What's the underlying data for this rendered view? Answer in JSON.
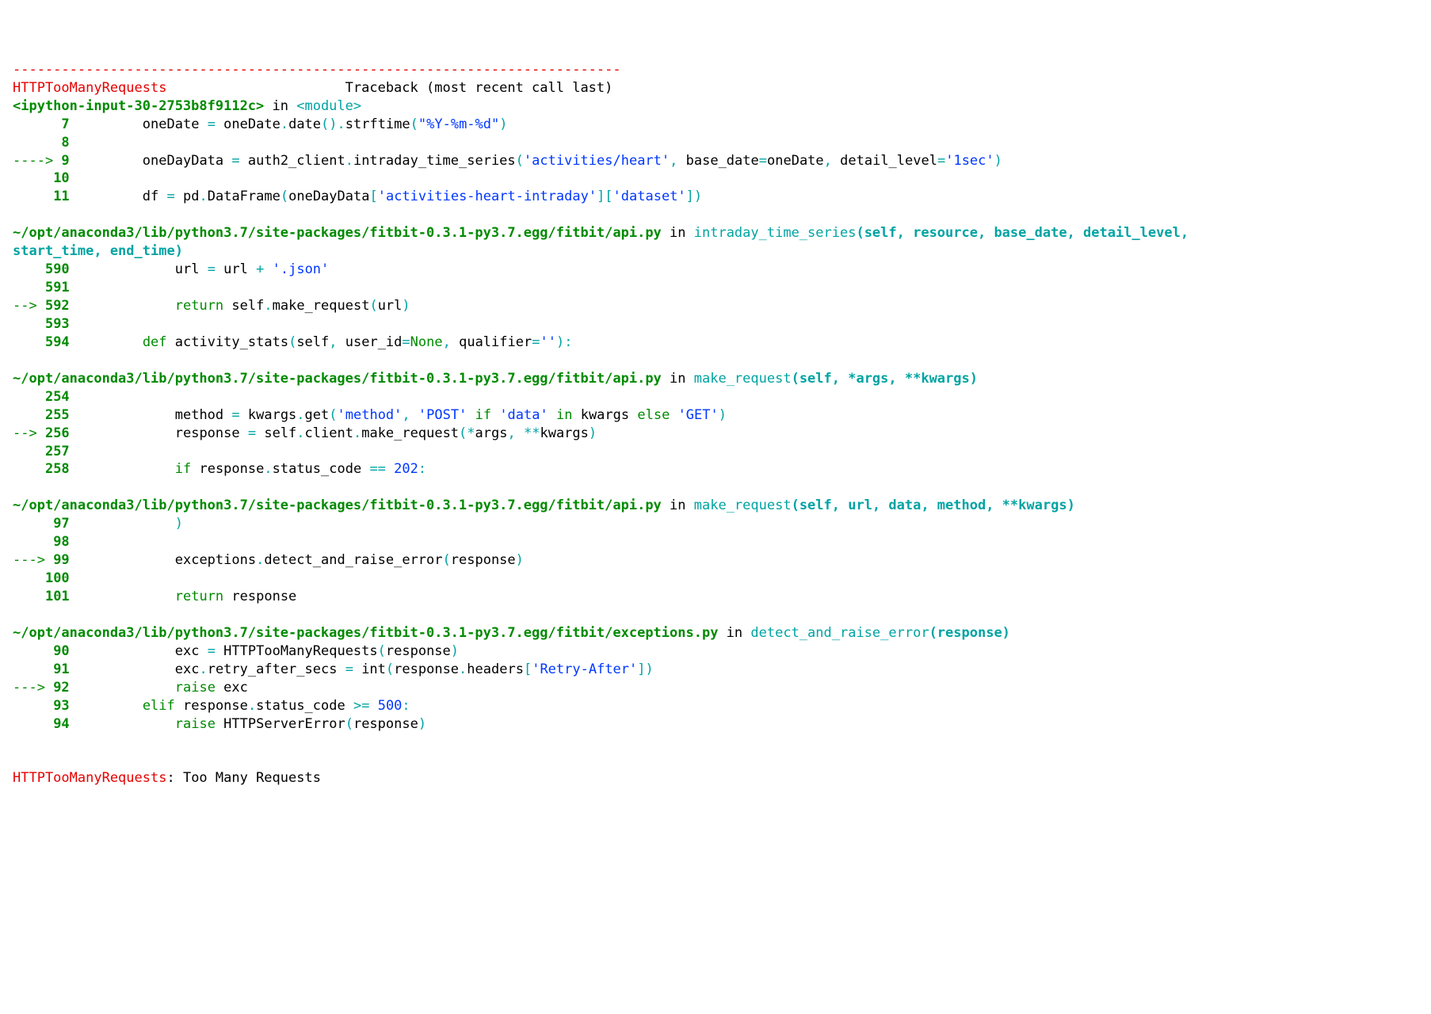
{
  "separator": "---------------------------------------------------------------------------",
  "header": {
    "exc_name": "HTTPTooManyRequests",
    "traceback_label": "Traceback (most recent call last)"
  },
  "frames": [
    {
      "loc_pre": "<ipython-input-30-2753b8f9112c>",
      "loc_join": " in ",
      "loc_func": "<module>",
      "lines": [
        {
          "arrow": false,
          "num": "7",
          "tokens": [
            {
              "t": "plain",
              "v": "        oneDate "
            },
            {
              "t": "cyan",
              "v": "="
            },
            {
              "t": "plain",
              "v": " oneDate"
            },
            {
              "t": "cyan",
              "v": "."
            },
            {
              "t": "plain",
              "v": "date"
            },
            {
              "t": "cyan",
              "v": "()."
            },
            {
              "t": "plain",
              "v": "strftime"
            },
            {
              "t": "cyan",
              "v": "("
            },
            {
              "t": "blue",
              "v": "\"%Y-%m-%d\""
            },
            {
              "t": "cyan",
              "v": ")"
            }
          ]
        },
        {
          "arrow": false,
          "num": "8",
          "tokens": []
        },
        {
          "arrow": true,
          "num": "9",
          "tokens": [
            {
              "t": "plain",
              "v": "        oneDayData "
            },
            {
              "t": "cyan",
              "v": "="
            },
            {
              "t": "plain",
              "v": " auth2_client"
            },
            {
              "t": "cyan",
              "v": "."
            },
            {
              "t": "plain",
              "v": "intraday_time_series"
            },
            {
              "t": "cyan",
              "v": "("
            },
            {
              "t": "blue",
              "v": "'activities/heart'"
            },
            {
              "t": "cyan",
              "v": ","
            },
            {
              "t": "plain",
              "v": " base_date"
            },
            {
              "t": "cyan",
              "v": "="
            },
            {
              "t": "plain",
              "v": "oneDate"
            },
            {
              "t": "cyan",
              "v": ","
            },
            {
              "t": "plain",
              "v": " detail_level"
            },
            {
              "t": "cyan",
              "v": "="
            },
            {
              "t": "blue",
              "v": "'1sec'"
            },
            {
              "t": "cyan",
              "v": ")"
            }
          ]
        },
        {
          "arrow": false,
          "num": "10",
          "tokens": []
        },
        {
          "arrow": false,
          "num": "11",
          "tokens": [
            {
              "t": "plain",
              "v": "        df "
            },
            {
              "t": "cyan",
              "v": "="
            },
            {
              "t": "plain",
              "v": " pd"
            },
            {
              "t": "cyan",
              "v": "."
            },
            {
              "t": "plain",
              "v": "DataFrame"
            },
            {
              "t": "cyan",
              "v": "("
            },
            {
              "t": "plain",
              "v": "oneDayData"
            },
            {
              "t": "cyan",
              "v": "["
            },
            {
              "t": "blue",
              "v": "'activities-heart-intraday'"
            },
            {
              "t": "cyan",
              "v": "]["
            },
            {
              "t": "blue",
              "v": "'dataset'"
            },
            {
              "t": "cyan",
              "v": "])"
            }
          ]
        }
      ]
    },
    {
      "loc_pre": "~/opt/anaconda3/lib/python3.7/site-packages/fitbit-0.3.1-py3.7.egg/fitbit/api.py",
      "loc_join": " in ",
      "loc_func": "intraday_time_series",
      "loc_sig": "(self, resource, base_date, detail_level, start_time, end_time)",
      "lines": [
        {
          "arrow": false,
          "num": "590",
          "tokens": [
            {
              "t": "plain",
              "v": "            url "
            },
            {
              "t": "cyan",
              "v": "="
            },
            {
              "t": "plain",
              "v": " url "
            },
            {
              "t": "cyan",
              "v": "+"
            },
            {
              "t": "plain",
              "v": " "
            },
            {
              "t": "blue",
              "v": "'.json'"
            }
          ]
        },
        {
          "arrow": false,
          "num": "591",
          "tokens": []
        },
        {
          "arrow": true,
          "num": "592",
          "tokens": [
            {
              "t": "plain",
              "v": "            "
            },
            {
              "t": "green",
              "v": "return"
            },
            {
              "t": "plain",
              "v": " self"
            },
            {
              "t": "cyan",
              "v": "."
            },
            {
              "t": "plain",
              "v": "make_request"
            },
            {
              "t": "cyan",
              "v": "("
            },
            {
              "t": "plain",
              "v": "url"
            },
            {
              "t": "cyan",
              "v": ")"
            }
          ]
        },
        {
          "arrow": false,
          "num": "593",
          "tokens": []
        },
        {
          "arrow": false,
          "num": "594",
          "tokens": [
            {
              "t": "plain",
              "v": "        "
            },
            {
              "t": "green",
              "v": "def"
            },
            {
              "t": "plain",
              "v": " activity_stats"
            },
            {
              "t": "cyan",
              "v": "("
            },
            {
              "t": "plain",
              "v": "self"
            },
            {
              "t": "cyan",
              "v": ","
            },
            {
              "t": "plain",
              "v": " user_id"
            },
            {
              "t": "cyan",
              "v": "="
            },
            {
              "t": "green",
              "v": "None"
            },
            {
              "t": "cyan",
              "v": ","
            },
            {
              "t": "plain",
              "v": " qualifier"
            },
            {
              "t": "cyan",
              "v": "="
            },
            {
              "t": "blue",
              "v": "''"
            },
            {
              "t": "cyan",
              "v": "):"
            }
          ]
        }
      ]
    },
    {
      "loc_pre": "~/opt/anaconda3/lib/python3.7/site-packages/fitbit-0.3.1-py3.7.egg/fitbit/api.py",
      "loc_join": " in ",
      "loc_func": "make_request",
      "loc_sig": "(self, *args, **kwargs)",
      "lines": [
        {
          "arrow": false,
          "num": "254",
          "tokens": []
        },
        {
          "arrow": false,
          "num": "255",
          "tokens": [
            {
              "t": "plain",
              "v": "            method "
            },
            {
              "t": "cyan",
              "v": "="
            },
            {
              "t": "plain",
              "v": " kwargs"
            },
            {
              "t": "cyan",
              "v": "."
            },
            {
              "t": "plain",
              "v": "get"
            },
            {
              "t": "cyan",
              "v": "("
            },
            {
              "t": "blue",
              "v": "'method'"
            },
            {
              "t": "cyan",
              "v": ","
            },
            {
              "t": "plain",
              "v": " "
            },
            {
              "t": "blue",
              "v": "'POST'"
            },
            {
              "t": "plain",
              "v": " "
            },
            {
              "t": "green",
              "v": "if"
            },
            {
              "t": "plain",
              "v": " "
            },
            {
              "t": "blue",
              "v": "'data'"
            },
            {
              "t": "plain",
              "v": " "
            },
            {
              "t": "green",
              "v": "in"
            },
            {
              "t": "plain",
              "v": " kwargs "
            },
            {
              "t": "green",
              "v": "else"
            },
            {
              "t": "plain",
              "v": " "
            },
            {
              "t": "blue",
              "v": "'GET'"
            },
            {
              "t": "cyan",
              "v": ")"
            }
          ]
        },
        {
          "arrow": true,
          "num": "256",
          "tokens": [
            {
              "t": "plain",
              "v": "            response "
            },
            {
              "t": "cyan",
              "v": "="
            },
            {
              "t": "plain",
              "v": " self"
            },
            {
              "t": "cyan",
              "v": "."
            },
            {
              "t": "plain",
              "v": "client"
            },
            {
              "t": "cyan",
              "v": "."
            },
            {
              "t": "plain",
              "v": "make_request"
            },
            {
              "t": "cyan",
              "v": "(*"
            },
            {
              "t": "plain",
              "v": "args"
            },
            {
              "t": "cyan",
              "v": ","
            },
            {
              "t": "plain",
              "v": " "
            },
            {
              "t": "cyan",
              "v": "**"
            },
            {
              "t": "plain",
              "v": "kwargs"
            },
            {
              "t": "cyan",
              "v": ")"
            }
          ]
        },
        {
          "arrow": false,
          "num": "257",
          "tokens": []
        },
        {
          "arrow": false,
          "num": "258",
          "tokens": [
            {
              "t": "plain",
              "v": "            "
            },
            {
              "t": "green",
              "v": "if"
            },
            {
              "t": "plain",
              "v": " response"
            },
            {
              "t": "cyan",
              "v": "."
            },
            {
              "t": "plain",
              "v": "status_code "
            },
            {
              "t": "cyan",
              "v": "=="
            },
            {
              "t": "plain",
              "v": " "
            },
            {
              "t": "blue",
              "v": "202"
            },
            {
              "t": "cyan",
              "v": ":"
            }
          ]
        }
      ]
    },
    {
      "loc_pre": "~/opt/anaconda3/lib/python3.7/site-packages/fitbit-0.3.1-py3.7.egg/fitbit/api.py",
      "loc_join": " in ",
      "loc_func": "make_request",
      "loc_sig": "(self, url, data, method, **kwargs)",
      "lines": [
        {
          "arrow": false,
          "num": "97",
          "tokens": [
            {
              "t": "plain",
              "v": "            "
            },
            {
              "t": "cyan",
              "v": ")"
            }
          ]
        },
        {
          "arrow": false,
          "num": "98",
          "tokens": []
        },
        {
          "arrow": true,
          "num": "99",
          "tokens": [
            {
              "t": "plain",
              "v": "            exceptions"
            },
            {
              "t": "cyan",
              "v": "."
            },
            {
              "t": "plain",
              "v": "detect_and_raise_error"
            },
            {
              "t": "cyan",
              "v": "("
            },
            {
              "t": "plain",
              "v": "response"
            },
            {
              "t": "cyan",
              "v": ")"
            }
          ]
        },
        {
          "arrow": false,
          "num": "100",
          "tokens": []
        },
        {
          "arrow": false,
          "num": "101",
          "tokens": [
            {
              "t": "plain",
              "v": "            "
            },
            {
              "t": "green",
              "v": "return"
            },
            {
              "t": "plain",
              "v": " response"
            }
          ]
        }
      ]
    },
    {
      "loc_pre": "~/opt/anaconda3/lib/python3.7/site-packages/fitbit-0.3.1-py3.7.egg/fitbit/exceptions.py",
      "loc_join": " in ",
      "loc_func": "detect_and_raise_error",
      "loc_sig": "(response)",
      "lines": [
        {
          "arrow": false,
          "num": "90",
          "tokens": [
            {
              "t": "plain",
              "v": "            exc "
            },
            {
              "t": "cyan",
              "v": "="
            },
            {
              "t": "plain",
              "v": " HTTPTooManyRequests"
            },
            {
              "t": "cyan",
              "v": "("
            },
            {
              "t": "plain",
              "v": "response"
            },
            {
              "t": "cyan",
              "v": ")"
            }
          ]
        },
        {
          "arrow": false,
          "num": "91",
          "tokens": [
            {
              "t": "plain",
              "v": "            exc"
            },
            {
              "t": "cyan",
              "v": "."
            },
            {
              "t": "plain",
              "v": "retry_after_secs "
            },
            {
              "t": "cyan",
              "v": "="
            },
            {
              "t": "plain",
              "v": " int"
            },
            {
              "t": "cyan",
              "v": "("
            },
            {
              "t": "plain",
              "v": "response"
            },
            {
              "t": "cyan",
              "v": "."
            },
            {
              "t": "plain",
              "v": "headers"
            },
            {
              "t": "cyan",
              "v": "["
            },
            {
              "t": "blue",
              "v": "'Retry-After'"
            },
            {
              "t": "cyan",
              "v": "])"
            }
          ]
        },
        {
          "arrow": true,
          "num": "92",
          "tokens": [
            {
              "t": "plain",
              "v": "            "
            },
            {
              "t": "green",
              "v": "raise"
            },
            {
              "t": "plain",
              "v": " exc"
            }
          ]
        },
        {
          "arrow": false,
          "num": "93",
          "tokens": [
            {
              "t": "plain",
              "v": "        "
            },
            {
              "t": "green",
              "v": "elif"
            },
            {
              "t": "plain",
              "v": " response"
            },
            {
              "t": "cyan",
              "v": "."
            },
            {
              "t": "plain",
              "v": "status_code "
            },
            {
              "t": "cyan",
              "v": ">="
            },
            {
              "t": "plain",
              "v": " "
            },
            {
              "t": "blue",
              "v": "500"
            },
            {
              "t": "cyan",
              "v": ":"
            }
          ]
        },
        {
          "arrow": false,
          "num": "94",
          "tokens": [
            {
              "t": "plain",
              "v": "            "
            },
            {
              "t": "green",
              "v": "raise"
            },
            {
              "t": "plain",
              "v": " HTTPServerError"
            },
            {
              "t": "cyan",
              "v": "("
            },
            {
              "t": "plain",
              "v": "response"
            },
            {
              "t": "cyan",
              "v": ")"
            }
          ]
        }
      ]
    }
  ],
  "final": {
    "exc_name": "HTTPTooManyRequests",
    "sep": ": ",
    "msg": "Too Many Requests"
  }
}
